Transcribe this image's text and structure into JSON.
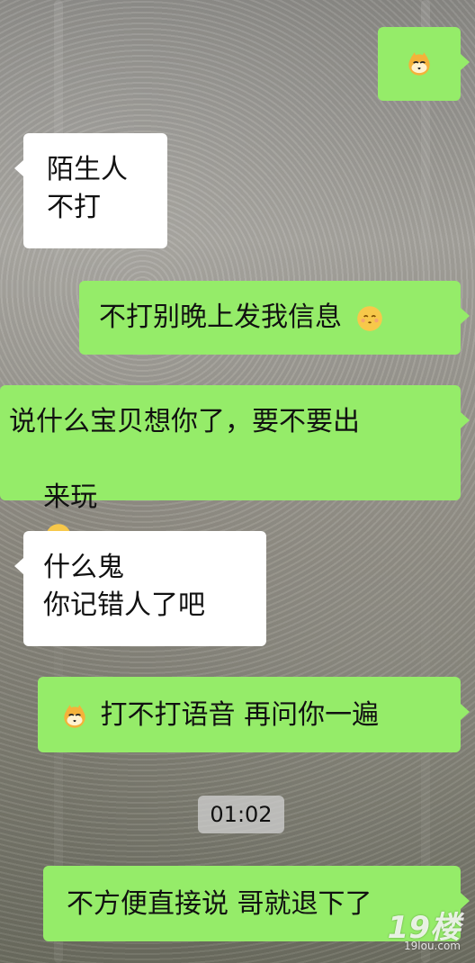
{
  "chat": {
    "messages": [
      {
        "id": "m1",
        "side": "right",
        "type": "emoji_only",
        "emoji": "cat-smirk-emoji"
      },
      {
        "id": "m2",
        "side": "left",
        "lines": [
          "陌生人",
          "不打"
        ]
      },
      {
        "id": "m3",
        "side": "right",
        "lines": [
          "不打别晚上发我信息"
        ],
        "trailing_emoji": "kissing-emoji"
      },
      {
        "id": "m4",
        "side": "right",
        "lines": [
          "说什么宝贝想你了，要不要出",
          "来玩"
        ],
        "trailing_emoji": "thinking-emoji"
      },
      {
        "id": "m5",
        "side": "left",
        "lines": [
          "什么鬼",
          "你记错人了吧"
        ]
      },
      {
        "id": "m6",
        "side": "right",
        "leading_emoji": "cat-smirk-emoji",
        "lines": [
          "打不打语音 再问你一遍"
        ]
      },
      {
        "id": "m7",
        "side": "right",
        "lines": [
          "不方便直接说 哥就退下了"
        ]
      }
    ],
    "timestamp": "01:02"
  },
  "watermark": {
    "big": "19楼",
    "small": "19lou.com"
  },
  "colors": {
    "bubble_green": "#95ec69",
    "bubble_white": "#ffffff",
    "text": "#111111"
  }
}
